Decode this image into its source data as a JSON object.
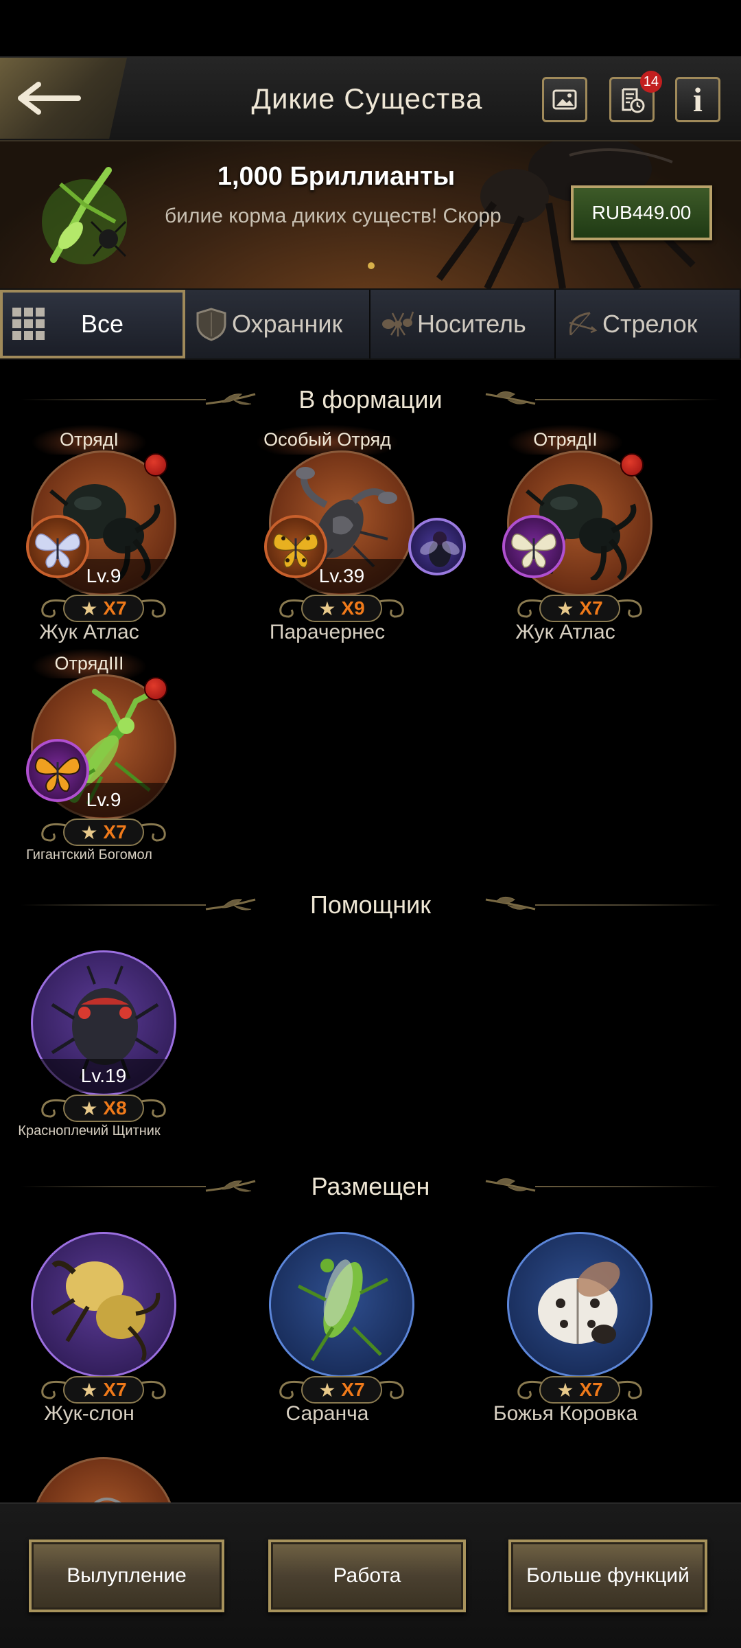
{
  "header": {
    "title": "Дикие Существа",
    "notification_count": "14",
    "info_label": "i"
  },
  "banner": {
    "title": "1,000 Бриллианты",
    "subtitle": "билие корма диких существ!    Скорр",
    "price": "RUB449.00"
  },
  "tabs": [
    {
      "label": "Все",
      "active": true
    },
    {
      "label": "Охранник",
      "active": false
    },
    {
      "label": "Носитель",
      "active": false
    },
    {
      "label": "Стрелок",
      "active": false
    }
  ],
  "sections": {
    "formation": "В формации",
    "helper": "Помощник",
    "placed": "Размещен"
  },
  "formation": [
    {
      "squad": "ОтрядI",
      "level": "Lv.9",
      "stars": "X7",
      "name": "Жук Атлас"
    },
    {
      "squad": "Особый Отряд",
      "level": "Lv.39",
      "stars": "X9",
      "name": "Парачернес"
    },
    {
      "squad": "ОтрядII",
      "level": "Lv.9",
      "stars": "X7",
      "name": "Жук Атлас"
    },
    {
      "squad": "ОтрядIII",
      "level": "Lv.9",
      "stars": "X7",
      "name": "Гигантский Богомол"
    }
  ],
  "helper": [
    {
      "level": "Lv.19",
      "stars": "X8",
      "name": "Красноплечий Щитник"
    }
  ],
  "placed": [
    {
      "stars": "X7",
      "name": "Жук-слон"
    },
    {
      "stars": "X7",
      "name": "Саранча"
    },
    {
      "stars": "X7",
      "name": "Божья Коровка"
    }
  ],
  "bottom": {
    "hatch": "Вылупление",
    "work": "Работа",
    "more": "Больше функций"
  },
  "star_glyph": "★"
}
